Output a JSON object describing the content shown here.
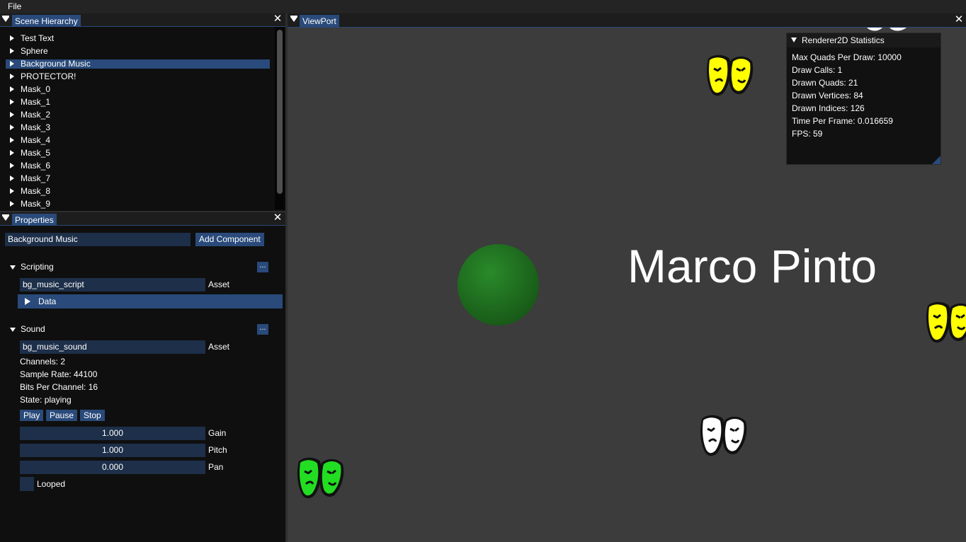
{
  "menubar": {
    "file_label": "File"
  },
  "hierarchy": {
    "tab_label": "Scene Hierarchy",
    "close_glyph": "✕",
    "items": [
      {
        "label": "Test Text",
        "selected": false
      },
      {
        "label": "Sphere",
        "selected": false
      },
      {
        "label": "Background Music",
        "selected": true
      },
      {
        "label": "PROTECTOR!",
        "selected": false
      },
      {
        "label": "Mask_0",
        "selected": false
      },
      {
        "label": "Mask_1",
        "selected": false
      },
      {
        "label": "Mask_2",
        "selected": false
      },
      {
        "label": "Mask_3",
        "selected": false
      },
      {
        "label": "Mask_4",
        "selected": false
      },
      {
        "label": "Mask_5",
        "selected": false
      },
      {
        "label": "Mask_6",
        "selected": false
      },
      {
        "label": "Mask_7",
        "selected": false
      },
      {
        "label": "Mask_8",
        "selected": false
      },
      {
        "label": "Mask_9",
        "selected": false
      }
    ]
  },
  "properties": {
    "tab_label": "Properties",
    "close_glyph": "✕",
    "entity_name": "Background Music",
    "add_component_label": "Add Component",
    "scripting": {
      "header": "Scripting",
      "more_label": "...",
      "asset_value": "bg_music_script",
      "asset_label": "Asset",
      "data_label": "Data"
    },
    "sound": {
      "header": "Sound",
      "more_label": "...",
      "asset_value": "bg_music_sound",
      "asset_label": "Asset",
      "channels": "Channels: 2",
      "sample_rate": "Sample Rate: 44100",
      "bits_per_channel": "Bits Per Channel: 16",
      "state": "State: playing",
      "play_label": "Play",
      "pause_label": "Pause",
      "stop_label": "Stop",
      "gain_value": "1.000",
      "gain_label": "Gain",
      "pitch_value": "1.000",
      "pitch_label": "Pitch",
      "pan_value": "0.000",
      "pan_label": "Pan",
      "looped_label": "Looped",
      "looped": false
    }
  },
  "viewport": {
    "tab_label": "ViewPort",
    "close_glyph": "✕",
    "scene_text": "Marco Pinto",
    "stats": {
      "title": "Renderer2D Statistics",
      "lines": [
        "Max Quads Per Draw: 10000",
        "Draw Calls: 1",
        "Drawn Quads: 21",
        "Drawn Vertices: 84",
        "Drawn Indices: 126",
        "Time Per Frame: 0.016659",
        "FPS: 59"
      ]
    },
    "masks": [
      {
        "color": "#ffff00"
      },
      {
        "color": "#ffff00"
      },
      {
        "color": "#ffffff"
      },
      {
        "color": "#22dd22"
      },
      {
        "color": "#ffffff"
      }
    ]
  },
  "colors": {
    "accent": "#294a7a",
    "field_bg": "#1d2f49",
    "panel_bg": "#0f0f0f",
    "viewport_bg": "#3c3c3c",
    "sphere": "#1f6d1f"
  }
}
